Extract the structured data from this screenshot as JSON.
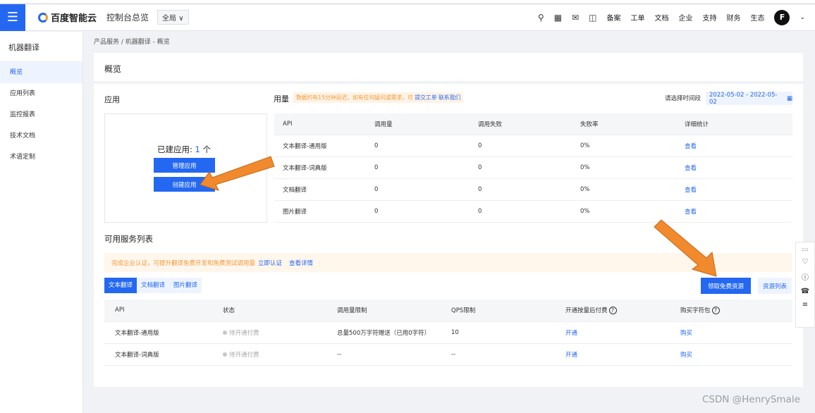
{
  "header": {
    "brand": "百度智能云",
    "console": "控制台总览",
    "region": "全局 ∨",
    "nav": [
      "备案",
      "工单",
      "文档",
      "企业",
      "支持",
      "财务",
      "生态"
    ],
    "avatar": "F"
  },
  "sidebar": {
    "title": "机器翻译",
    "items": [
      "概览",
      "应用列表",
      "监控报表",
      "技术文档",
      "术语定制"
    ]
  },
  "breadcrumb": "产品服务 / 机器翻译 - 概览",
  "page_title": "概览",
  "apps": {
    "title": "应用",
    "built_prefix": "已建应用: ",
    "built_count": "1",
    "built_suffix": " 个",
    "manage": "管理应用",
    "create": "创建应用"
  },
  "usage": {
    "title": "用量",
    "notice": "数据约有15分钟延迟，如有任何疑问或需求，可 ",
    "notice_link": "提交工单 联系我们",
    "date_label": "请选择时间段",
    "date_range": "2022-05-02 - 2022-05-02",
    "columns": [
      "API",
      "调用量",
      "调用失败",
      "失败率",
      "详细统计"
    ],
    "rows": [
      [
        "文本翻译-通用版",
        "0",
        "0",
        "0%",
        "查看"
      ],
      [
        "文本翻译-词典版",
        "0",
        "0",
        "0%",
        "查看"
      ],
      [
        "文档翻译",
        "0",
        "0",
        "0%",
        "查看"
      ],
      [
        "图片翻译",
        "0",
        "0",
        "0%",
        "查看"
      ]
    ]
  },
  "services": {
    "title": "可用服务列表",
    "banner": "完成企业认证，可提升翻译免费开发和免费测试调用量",
    "banner_link1": "立即认证",
    "banner_link2": "查看详情",
    "tabs": [
      "文本翻译",
      "文档翻译",
      "图片翻译"
    ],
    "free_button": "领取免费资源",
    "resource_list": "资源列表",
    "columns": [
      "API",
      "状态",
      "调用量限制",
      "QPS限制",
      "开通按量后付费",
      "购买字符包"
    ],
    "rows": [
      [
        "文本翻译-通用版",
        "待开通付费",
        "总量500万字符赠送（已用0字符）",
        "10",
        "开通",
        "购买"
      ],
      [
        "文本翻译-词典版",
        "待开通付费",
        "--",
        "--",
        "开通",
        "购买"
      ]
    ]
  },
  "watermark": "CSDN @HenrySmale",
  "colors": {
    "primary": "#2468f2",
    "arrow": "#f08a2c",
    "notice": "#f39a3a"
  },
  "icons": [
    "menu-icon",
    "search-icon",
    "grid-icon",
    "message-icon",
    "cart-icon",
    "chevron-down-icon",
    "calendar-icon",
    "help-icon"
  ]
}
